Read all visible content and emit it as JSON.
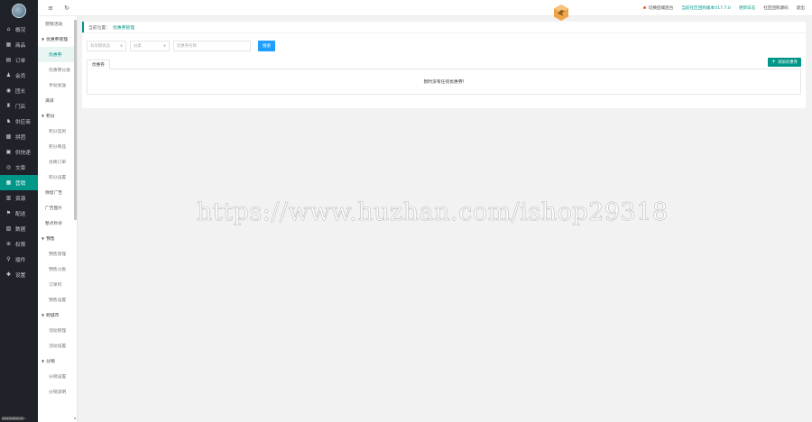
{
  "sidebar": {
    "items": [
      {
        "label": "概况",
        "icon": "home-icon",
        "glyph": "⌂"
      },
      {
        "label": "商品",
        "icon": "grid-icon",
        "glyph": "▦"
      },
      {
        "label": "订单",
        "icon": "order-icon",
        "glyph": "▤"
      },
      {
        "label": "会员",
        "icon": "user-icon",
        "glyph": "♟"
      },
      {
        "label": "团长",
        "icon": "badge-icon",
        "glyph": "◉"
      },
      {
        "label": "门店",
        "icon": "store-icon",
        "glyph": "♜"
      },
      {
        "label": "供应商",
        "icon": "supplier-icon",
        "glyph": "♞"
      },
      {
        "label": "拼团",
        "icon": "group-buy-icon",
        "glyph": "▩"
      },
      {
        "label": "供快递",
        "icon": "delivery-icon",
        "glyph": "▣"
      },
      {
        "label": "文章",
        "icon": "article-icon",
        "glyph": "◎"
      },
      {
        "label": "营销",
        "icon": "marketing-icon",
        "glyph": "▦"
      },
      {
        "label": "资源",
        "icon": "resource-icon",
        "glyph": "▥"
      },
      {
        "label": "配送",
        "icon": "shipping-icon",
        "glyph": "⚑"
      },
      {
        "label": "数据",
        "icon": "data-icon",
        "glyph": "▧"
      },
      {
        "label": "权限",
        "icon": "permission-icon",
        "glyph": "⊕"
      },
      {
        "label": "插件",
        "icon": "plugin-icon",
        "glyph": "⚲"
      },
      {
        "label": "设置",
        "icon": "gear-icon",
        "glyph": "✱"
      }
    ],
    "active_index": 10
  },
  "subnav": {
    "items": [
      {
        "label": "营销活动",
        "kind": "item"
      },
      {
        "label": "优惠券管理",
        "kind": "group"
      },
      {
        "label": "优惠券",
        "kind": "child",
        "active": true
      },
      {
        "label": "优惠券分类",
        "kind": "child"
      },
      {
        "label": "手动发送",
        "kind": "child"
      },
      {
        "label": "满减",
        "kind": "item"
      },
      {
        "label": "积分",
        "kind": "group"
      },
      {
        "label": "积分签到",
        "kind": "child"
      },
      {
        "label": "积分商品",
        "kind": "child"
      },
      {
        "label": "兑换订单",
        "kind": "child"
      },
      {
        "label": "积分设置",
        "kind": "child"
      },
      {
        "label": "弹窗广告",
        "kind": "item"
      },
      {
        "label": "广告图片",
        "kind": "item"
      },
      {
        "label": "整点秒杀",
        "kind": "item"
      },
      {
        "label": "预售",
        "kind": "group"
      },
      {
        "label": "预售管理",
        "kind": "child"
      },
      {
        "label": "预售分类",
        "kind": "child"
      },
      {
        "label": "订单列",
        "kind": "child"
      },
      {
        "label": "预售设置",
        "kind": "child"
      },
      {
        "label": "跨城市",
        "kind": "group"
      },
      {
        "label": "活动管理",
        "kind": "child"
      },
      {
        "label": "活动设置",
        "kind": "child"
      },
      {
        "label": "分销",
        "kind": "group"
      },
      {
        "label": "分销设置",
        "kind": "child"
      },
      {
        "label": "分销说明",
        "kind": "child"
      }
    ]
  },
  "topbar": {
    "menu_icon": "≡",
    "refresh_icon": "↻",
    "status_text": "切换后端后台",
    "version_text": "当前社区团购版本V17.7.0",
    "update_log": "更新日志",
    "community_text": "社区团购源码",
    "logout": "退出"
  },
  "breadcrumb": {
    "prefix": "当前位置：",
    "current": "优惠券管理"
  },
  "filters": {
    "type_placeholder": "有效期状态",
    "status_placeholder": "分类",
    "keyword_placeholder": "优惠券名称",
    "search_label": "搜索"
  },
  "tabs": {
    "active_label": "优惠券"
  },
  "add_button": {
    "plus": "+",
    "label": "添加优惠券"
  },
  "table": {
    "empty_text": "暂时没有任何优惠券!"
  },
  "watermark": {
    "text": "https://www.huzhan.com/ishop29318"
  },
  "footer_badge": "www.huzhan.com",
  "colors": {
    "sidebar_bg": "#20222a",
    "accent": "#009688",
    "search_btn": "#1e9fff",
    "status_dot": "#ff5722"
  }
}
